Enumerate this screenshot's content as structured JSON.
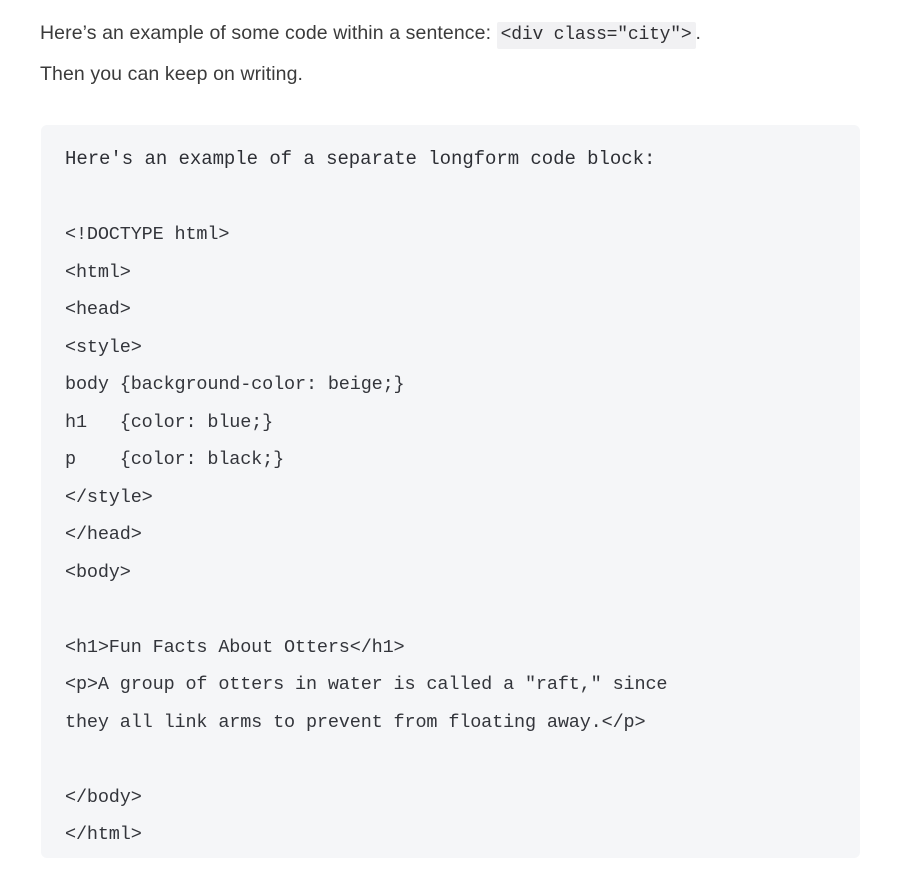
{
  "document": {
    "intro": {
      "line1_before_code": "Here’s an example of some code within a sentence: ",
      "inline_code": "<div class=\"city\">",
      "line1_after_code": ".",
      "line2": "Then you can keep on writing."
    },
    "code_block": {
      "header": "Here's an example of a separate longform code block:",
      "lines": [
        "",
        "<!DOCTYPE html>",
        "<html>",
        "<head>",
        "<style>",
        "body {background-color: beige;}",
        "h1   {color: blue;}",
        "p    {color: black;}",
        "</style>",
        "</head>",
        "<body>",
        "",
        "<h1>Fun Facts About Otters</h1>",
        "<p>A group of otters in water is called a \"raft,\" since",
        "they all link arms to prevent from floating away.</p>",
        "",
        "</body>",
        "</html>"
      ]
    },
    "colors": {
      "page_background": "#ffffff",
      "code_block_background": "#f5f6f8",
      "inline_code_background": "#f1f1f3",
      "body_text": "#3b3b3b",
      "code_text": "#33353b"
    }
  }
}
